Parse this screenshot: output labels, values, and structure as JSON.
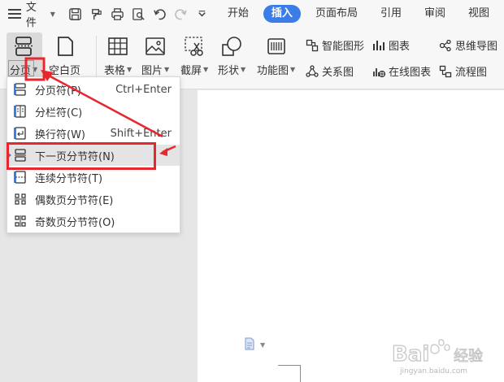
{
  "menubar": {
    "file_label": "文件",
    "tabs": [
      {
        "label": "开始",
        "active": false
      },
      {
        "label": "插入",
        "active": true
      },
      {
        "label": "页面布局",
        "active": false
      },
      {
        "label": "引用",
        "active": false
      },
      {
        "label": "审阅",
        "active": false
      },
      {
        "label": "视图",
        "active": false
      }
    ]
  },
  "ribbon": {
    "page_break": "分页",
    "blank_page": "空白页",
    "table": "表格",
    "picture": "图片",
    "screenshot": "截屏",
    "shape": "形状",
    "function_chart": "功能图",
    "smart_shape": "智能图形",
    "chart": "图表",
    "mind_map": "思维导图",
    "relation_chart": "关系图",
    "online_chart": "在线图表",
    "flowchart": "流程图"
  },
  "dropdown": {
    "items": [
      {
        "label": "分页符(P)",
        "shortcut": "Ctrl+Enter"
      },
      {
        "label": "分栏符(C)",
        "shortcut": ""
      },
      {
        "label": "换行符(W)",
        "shortcut": "Shift+Enter"
      },
      {
        "label": "下一页分节符(N)",
        "shortcut": ""
      },
      {
        "label": "连续分节符(T)",
        "shortcut": ""
      },
      {
        "label": "偶数页分节符(E)",
        "shortcut": ""
      },
      {
        "label": "奇数页分节符(O)",
        "shortcut": ""
      }
    ],
    "highlighted_index": 3
  },
  "colors": {
    "accent": "#3a7ce8",
    "annotation_red": "#e8262d"
  },
  "watermark": {
    "logo_text": "Baidu经验",
    "url": "jingyan.baidu.com"
  }
}
